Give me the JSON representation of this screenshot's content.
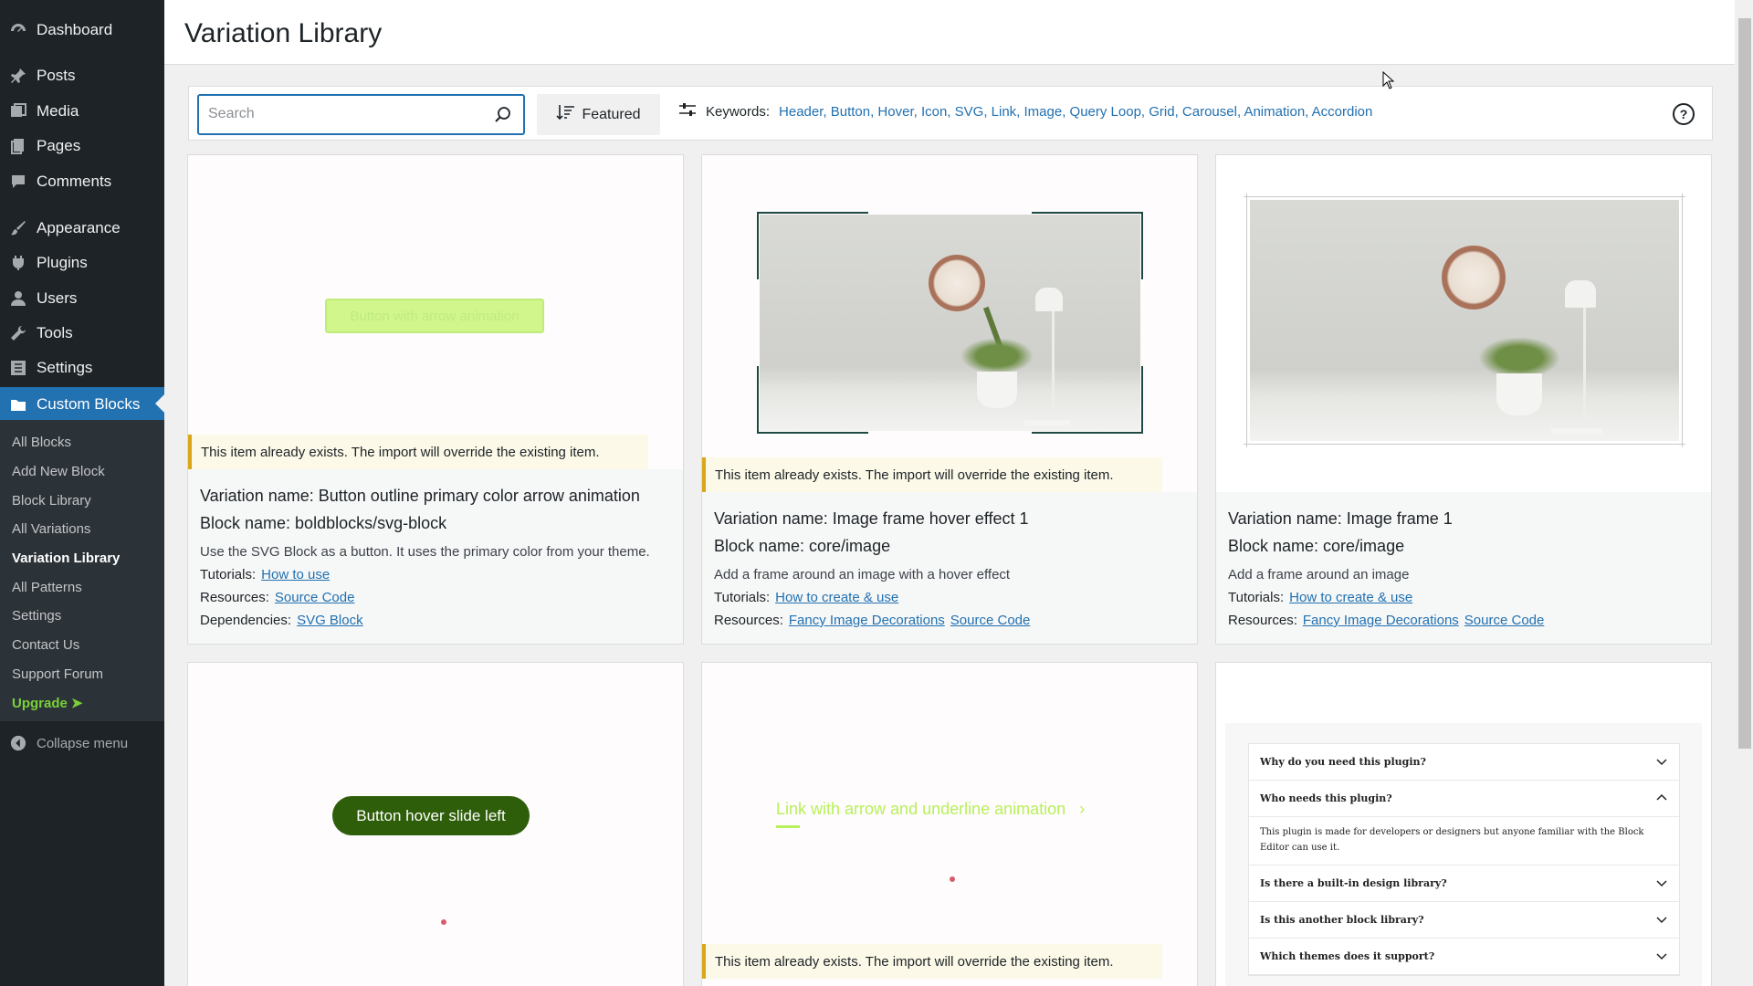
{
  "sidebar": {
    "items": [
      {
        "label": "Dashboard",
        "icon": "dashboard-icon"
      },
      {
        "label": "Posts",
        "icon": "pin-icon"
      },
      {
        "label": "Media",
        "icon": "media-icon"
      },
      {
        "label": "Pages",
        "icon": "pages-icon"
      },
      {
        "label": "Comments",
        "icon": "comment-icon"
      },
      {
        "label": "Appearance",
        "icon": "brush-icon"
      },
      {
        "label": "Plugins",
        "icon": "plug-icon"
      },
      {
        "label": "Users",
        "icon": "user-icon"
      },
      {
        "label": "Tools",
        "icon": "wrench-icon"
      },
      {
        "label": "Settings",
        "icon": "settings-icon"
      },
      {
        "label": "Custom Blocks",
        "icon": "folder-icon"
      }
    ],
    "submenu": [
      "All Blocks",
      "Add New Block",
      "Block Library",
      "All Variations",
      "Variation Library",
      "All Patterns",
      "Settings",
      "Contact Us",
      "Support Forum",
      "Upgrade ➤"
    ],
    "collapse_label": "Collapse menu"
  },
  "page": {
    "title": "Variation Library"
  },
  "toolbar": {
    "search_placeholder": "Search",
    "featured_label": "Featured",
    "keywords_label": "Keywords:",
    "keywords": "Header, Button, Hover, Icon, SVG, Link, Image, Query Loop, Grid, Carousel, Animation, Accordion"
  },
  "notice_text": "This item already exists. The import will override the existing item.",
  "cards": [
    {
      "variation": "Variation name: Button outline primary color arrow animation",
      "block": "Block name: boldblocks/svg-block",
      "description": "Use the SVG Block as a button. It uses the primary color from your theme.",
      "tutorials_label": "Tutorials:",
      "tutorials": [
        "How to use"
      ],
      "resources_label": "Resources:",
      "resources": [
        "Source Code"
      ],
      "dependencies_label": "Dependencies:",
      "dependencies": [
        "SVG Block"
      ],
      "preview_text": "Button with arrow animation"
    },
    {
      "variation": "Variation name: Image frame hover effect 1",
      "block": "Block name: core/image",
      "description": "Add a frame around an image with a hover effect",
      "tutorials_label": "Tutorials:",
      "tutorials": [
        "How to create & use"
      ],
      "resources_label": "Resources:",
      "resources": [
        "Fancy Image Decorations",
        "Source Code"
      ]
    },
    {
      "variation": "Variation name: Image frame 1",
      "block": "Block name: core/image",
      "description": "Add a frame around an image",
      "tutorials_label": "Tutorials:",
      "tutorials": [
        "How to create & use"
      ],
      "resources_label": "Resources:",
      "resources": [
        "Fancy Image Decorations",
        "Source Code"
      ]
    },
    {
      "preview_text": "Button hover slide left"
    },
    {
      "preview_text": "Link with arrow and underline animation"
    },
    {
      "accordion": [
        {
          "q": "Why do you need this plugin?",
          "open": false
        },
        {
          "q": "Who needs this plugin?",
          "open": true,
          "a": "This plugin is made for developers or designers but anyone familiar with the Block Editor can use it."
        },
        {
          "q": "Is there a built-in design library?",
          "open": false
        },
        {
          "q": "Is this another block library?",
          "open": false
        },
        {
          "q": "Which themes does it support?",
          "open": false
        }
      ]
    }
  ],
  "colors": {
    "accent": "#2271b1",
    "sidebar": "#1d2327",
    "lime": "#b8f05a",
    "dark_green": "#2e5e0a",
    "notice": "#dba617"
  }
}
